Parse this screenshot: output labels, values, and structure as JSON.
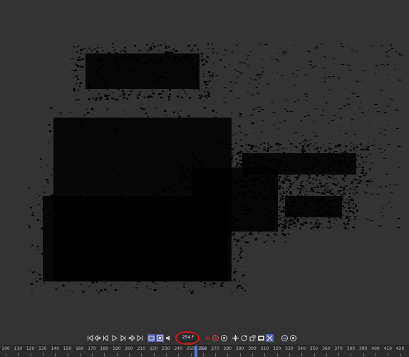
{
  "viewport": {
    "description_icon": "point-cloud-view"
  },
  "transport": {
    "buttons": [
      {
        "name": "go-to-start-button",
        "icon": "skip-start-icon"
      },
      {
        "name": "previous-keyframe-button",
        "icon": "prev-key-icon"
      },
      {
        "name": "step-back-button",
        "icon": "step-back-icon"
      },
      {
        "name": "play-button",
        "icon": "play-icon"
      },
      {
        "name": "step-forward-button",
        "icon": "step-forward-icon"
      },
      {
        "name": "next-keyframe-button",
        "icon": "next-key-icon"
      },
      {
        "name": "go-to-end-button",
        "icon": "skip-end-icon"
      },
      {
        "name": "loop-button",
        "icon": "loop-icon"
      },
      {
        "name": "range-button",
        "icon": "range-icon"
      },
      {
        "name": "sound-button",
        "icon": "speaker-icon"
      }
    ],
    "current_frame": "254 F",
    "tools": [
      {
        "name": "record-button",
        "icon": "record-icon"
      },
      {
        "name": "autokey-button",
        "icon": "autokey-icon"
      },
      {
        "name": "keyframe-button",
        "icon": "keyframe-icon"
      },
      {
        "name": "move-button",
        "icon": "move-icon"
      },
      {
        "name": "rotate-button",
        "icon": "rotate-icon"
      },
      {
        "name": "scale-button",
        "icon": "scale-icon"
      },
      {
        "name": "param-button",
        "icon": "param-icon"
      },
      {
        "name": "pla-button",
        "icon": "pla-icon"
      },
      {
        "name": "motion-button",
        "icon": "motion-icon"
      },
      {
        "name": "settings-button",
        "icon": "settings-icon"
      }
    ],
    "colors": {
      "active": "#5865a8",
      "highlight_circle": "#d31818"
    }
  },
  "timeline": {
    "ticks": [
      "100",
      "110",
      "120",
      "130",
      "140",
      "150",
      "160",
      "170",
      "180",
      "190",
      "200",
      "210",
      "220",
      "230",
      "240",
      "250",
      "260",
      "270",
      "280",
      "290",
      "300",
      "310",
      "320",
      "330",
      "340",
      "350",
      "360",
      "370",
      "380",
      "390",
      "400",
      "410",
      "420"
    ],
    "playhead_label": "254",
    "playhead_color": "#5a78d6"
  }
}
